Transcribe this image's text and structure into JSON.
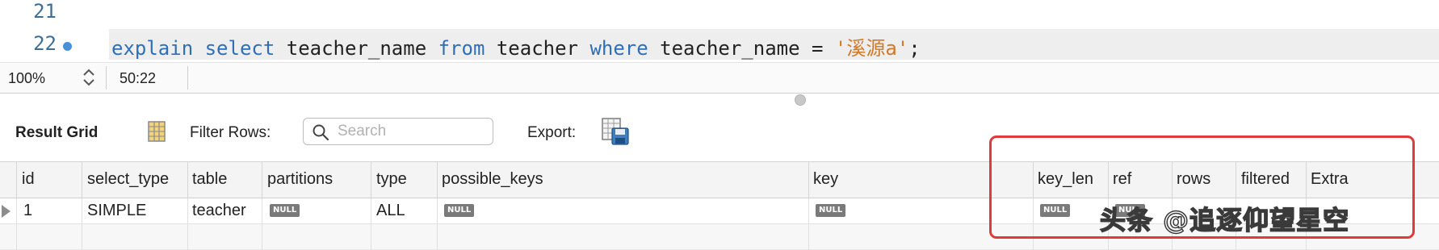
{
  "editor": {
    "lines": [
      {
        "number": "21",
        "code": ""
      },
      {
        "number": "22",
        "tokens": [
          {
            "text": "explain",
            "kind": "keyword"
          },
          {
            "text": " ",
            "kind": "plain"
          },
          {
            "text": "select",
            "kind": "keyword"
          },
          {
            "text": " teacher_name ",
            "kind": "plain"
          },
          {
            "text": "from",
            "kind": "keyword"
          },
          {
            "text": " teacher ",
            "kind": "plain"
          },
          {
            "text": "where",
            "kind": "keyword"
          },
          {
            "text": " teacher_name = ",
            "kind": "plain"
          },
          {
            "text": "'溪源a'",
            "kind": "string"
          },
          {
            "text": ";",
            "kind": "plain"
          }
        ]
      }
    ]
  },
  "statusbar": {
    "zoom": "100%",
    "cursor_position": "50:22"
  },
  "toolbar": {
    "result_grid_label": "Result Grid",
    "filter_rows_label": "Filter Rows:",
    "search_placeholder": "Search",
    "export_label": "Export:"
  },
  "grid": {
    "columns": [
      "id",
      "select_type",
      "table",
      "partitions",
      "type",
      "possible_keys",
      "key",
      "key_len",
      "ref",
      "rows",
      "filtered",
      "Extra"
    ],
    "rows": [
      {
        "id": "1",
        "select_type": "SIMPLE",
        "table": "teacher",
        "partitions": "NULL",
        "type": "ALL",
        "possible_keys": "NULL",
        "key": "NULL",
        "key_len": "NULL",
        "ref": "NULL",
        "rows": "",
        "filtered": "",
        "Extra": ""
      }
    ],
    "null_label": "NULL"
  },
  "colors": {
    "keyword": "#2f6fb7",
    "string": "#cf7a28",
    "highlight_box": "#e03b3b"
  },
  "watermark": {
    "text": "头条 @追逐仰望星空"
  }
}
